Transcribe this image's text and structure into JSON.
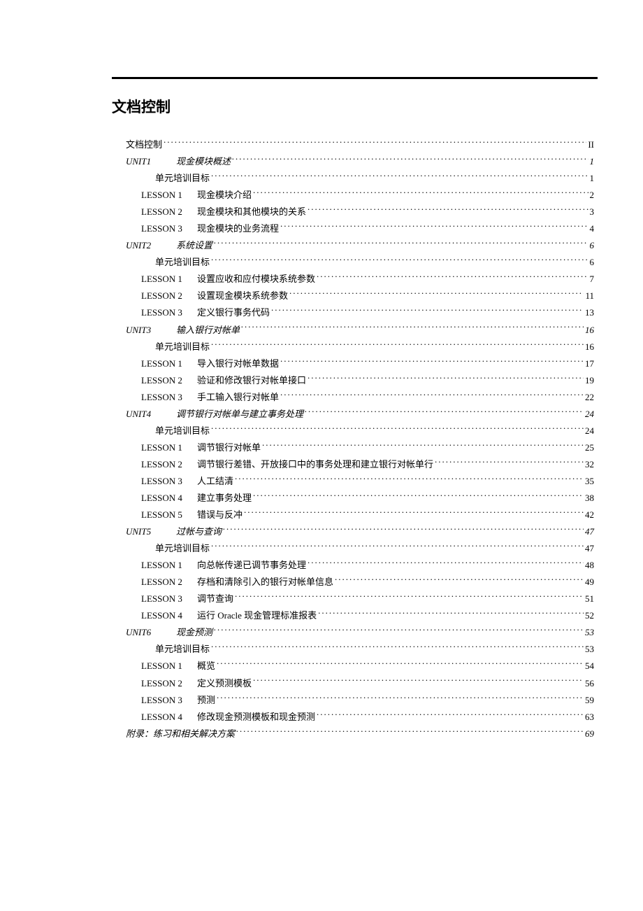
{
  "heading": "文档控制",
  "toc": [
    {
      "level": 0,
      "label": "文档控制",
      "page": "II"
    },
    {
      "level": 1,
      "unit": "UNIT1",
      "title": "现金模块概述",
      "page": "1"
    },
    {
      "level": 2,
      "label": "单元培训目标",
      "page": "1"
    },
    {
      "level": 3,
      "code": "LESSON 1",
      "title": "现金模块介绍",
      "page": "2"
    },
    {
      "level": 3,
      "code": "LESSON 2",
      "title": "现金模块和其他模块的关系",
      "page": "3"
    },
    {
      "level": 3,
      "code": "LESSON 3",
      "title": "现金模块的业务流程",
      "page": "4"
    },
    {
      "level": 1,
      "unit": "UNIT2",
      "title": "系统设置",
      "page": "6"
    },
    {
      "level": 2,
      "label": "单元培训目标",
      "page": "6"
    },
    {
      "level": 3,
      "code": "LESSON 1",
      "title": "设置应收和应付模块系统参数",
      "page": "7"
    },
    {
      "level": 3,
      "code": "LESSON 2",
      "title": "设置现金模块系统参数",
      "page": "11"
    },
    {
      "level": 3,
      "code": "LESSON 3",
      "title": "定义银行事务代码",
      "page": "13"
    },
    {
      "level": 1,
      "unit": "UNIT3",
      "title": "输入银行对帐单",
      "page": "16"
    },
    {
      "level": 2,
      "label": "单元培训目标",
      "page": "16"
    },
    {
      "level": 3,
      "code": "LESSON 1",
      "title": "导入银行对帐单数据",
      "page": "17"
    },
    {
      "level": 3,
      "code": "LESSON 2",
      "title": "验证和修改银行对帐单接口",
      "page": "19"
    },
    {
      "level": 3,
      "code": "LESSON 3",
      "title": "手工输入银行对帐单",
      "page": "22"
    },
    {
      "level": 1,
      "unit": "UNIT4",
      "title": "调节银行对帐单与建立事务处理",
      "page": "24"
    },
    {
      "level": 2,
      "label": "单元培训目标",
      "page": "24"
    },
    {
      "level": 3,
      "code": "LESSON 1",
      "title": "调节银行对帐单",
      "page": "25"
    },
    {
      "level": 3,
      "code": "LESSON 2",
      "title": "调节银行差错、开放接口中的事务处理和建立银行对帐单行",
      "page": "32"
    },
    {
      "level": 3,
      "code": "LESSON 3",
      "title": "人工结清",
      "page": "35"
    },
    {
      "level": 3,
      "code": "LESSON 4",
      "title": "建立事务处理",
      "page": "38"
    },
    {
      "level": 3,
      "code": "LESSON 5",
      "title": "错误与反冲",
      "page": "42"
    },
    {
      "level": 1,
      "unit": "UNIT5",
      "title": "过帐与查询",
      "page": "47"
    },
    {
      "level": 2,
      "label": "单元培训目标",
      "page": "47"
    },
    {
      "level": 3,
      "code": "LESSON 1",
      "title": "向总帐传递已调节事务处理",
      "page": "48"
    },
    {
      "level": 3,
      "code": "LESSON 2",
      "title": "存档和清除引入的银行对帐单信息",
      "page": "49"
    },
    {
      "level": 3,
      "code": "LESSON 3",
      "title": "调节查询",
      "page": "51"
    },
    {
      "level": 3,
      "code": "LESSON 4",
      "title": "运行 Oracle 现金管理标准报表",
      "page": "52"
    },
    {
      "level": 1,
      "unit": "UNIT6",
      "title": "现金预测",
      "page": "53"
    },
    {
      "level": 2,
      "label": "单元培训目标",
      "page": "53"
    },
    {
      "level": 3,
      "code": "LESSON 1",
      "title": "概览",
      "page": "54"
    },
    {
      "level": 3,
      "code": "LESSON 2",
      "title": "定义预测模板",
      "page": "56"
    },
    {
      "level": 3,
      "code": "LESSON 3",
      "title": "预测",
      "page": "59"
    },
    {
      "level": 3,
      "code": "LESSON 4",
      "title": "修改现金预测模板和现金预测",
      "page": "63"
    },
    {
      "level": 1,
      "appendix": true,
      "label": "附录：练习和相关解决方案",
      "page": "69"
    }
  ]
}
